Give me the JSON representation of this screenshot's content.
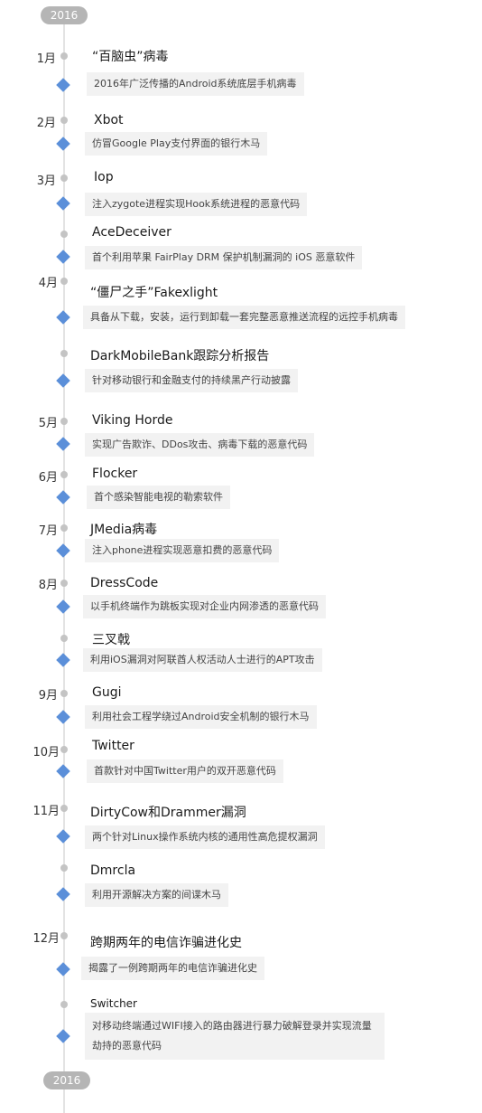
{
  "year_top": "2016",
  "year_bottom": "2016",
  "items": [
    {
      "month": "1月",
      "title": "“百脑虫”病毒",
      "desc": "2016年广泛传播的Android系统底层手机病毒"
    },
    {
      "month": "2月",
      "title": "Xbot",
      "desc": "仿冒Google Play支付界面的银行木马"
    },
    {
      "month": "3月",
      "title": "Iop",
      "desc": "注入zygote进程实现Hook系统进程的恶意代码"
    },
    {
      "month": "",
      "title": "AceDeceiver",
      "desc": "首个利用苹果 FairPlay DRM 保护机制漏洞的 iOS 恶意软件"
    },
    {
      "month": "4月",
      "title": "“僵尸之手”Fakexlight",
      "desc": "具备从下载，安装，运行到卸载一套完整恶意推送流程的远控手机病毒"
    },
    {
      "month": "",
      "title": "DarkMobileBank跟踪分析报告",
      "desc": "针对移动银行和金融支付的持续黑产行动披露"
    },
    {
      "month": "5月",
      "title": "Viking Horde",
      "desc": "实现广告欺诈、DDos攻击、病毒下载的恶意代码"
    },
    {
      "month": "6月",
      "title": "Flocker",
      "desc": "首个感染智能电视的勒索软件"
    },
    {
      "month": "7月",
      "title": "JMedia病毒",
      "desc": "注入phone进程实现恶意扣费的恶意代码"
    },
    {
      "month": "8月",
      "title": "DressCode",
      "desc": "以手机终端作为跳板实现对企业内网渗透的恶意代码"
    },
    {
      "month": "",
      "title": "三叉戟",
      "desc": "利用iOS漏洞对阿联酋人权活动人士进行的APT攻击"
    },
    {
      "month": "9月",
      "title": "Gugi",
      "desc": "利用社会工程学绕过Android安全机制的银行木马"
    },
    {
      "month": "10月",
      "title": "Twitter",
      "desc": "首款针对中国Twitter用户的双开恶意代码"
    },
    {
      "month": "11月",
      "title": "DirtyCow和Drammer漏洞",
      "desc": "两个针对Linux操作系统内核的通用性高危提权漏洞"
    },
    {
      "month": "",
      "title": "Dmrcla",
      "desc": "利用开源解决方案的间谍木马"
    },
    {
      "month": "12月",
      "title": "跨期两年的电信诈骗进化史",
      "desc": "揭露了一例跨期两年的电信诈骗进化史"
    },
    {
      "month": "",
      "title": "Switcher",
      "desc": "对移动终端通过WIFI接入的路由器进行暴力破解登录并实现流量劫持的恶意代码"
    }
  ]
}
